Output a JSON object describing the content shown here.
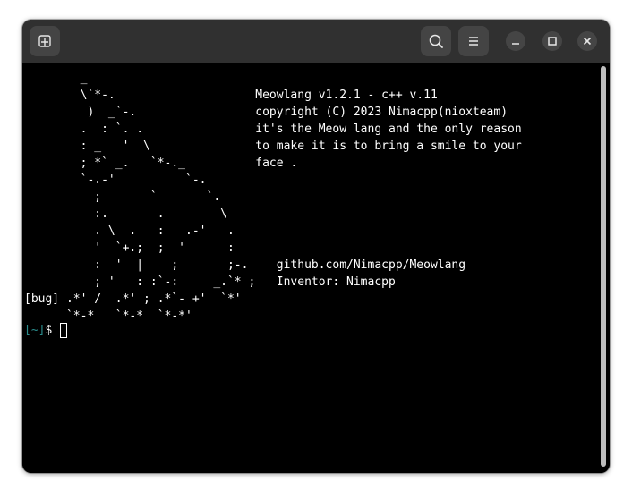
{
  "titlebar": {
    "new_tab_icon": "new-tab-icon",
    "search_icon": "search-icon",
    "menu_icon": "hamburger-menu-icon",
    "minimize_icon": "minimize-icon",
    "maximize_icon": "maximize-icon",
    "close_icon": "close-icon"
  },
  "terminal": {
    "lines": [
      "        _",
      "        \\`*-.                    Meowlang v1.2.1 - c++ v.11",
      "         )  _`-.                 copyright (C) 2023 Nimacpp(nioxteam)",
      "        .  : `. .                it's the Meow lang and the only reason",
      "        : _   '  \\               to make it is to bring a smile to your",
      "        ; *` _.   `*-._          face .",
      "        `-.-'          `-.",
      "          ;       `       `.",
      "          :.       .        \\",
      "          . \\  .   :   .-'   .",
      "          '  `+.;  ;  '      :",
      "          :  '  |    ;       ;-.    github.com/Nimacpp/Meowlang",
      "          ; '   : :`-:     _.`* ;   Inventor: Nimacpp",
      "[bug] .*' /  .*' ; .*`- +'  `*'",
      "      `*-*   `*-*  `*-*'"
    ],
    "prompt_dir": "[~]",
    "prompt_symbol": "$"
  }
}
